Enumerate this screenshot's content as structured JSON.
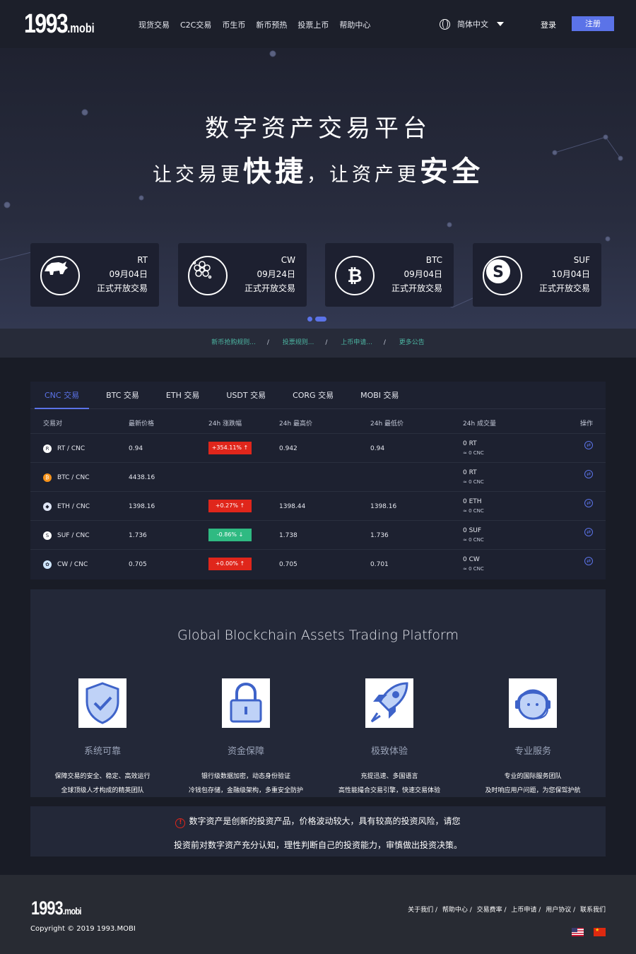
{
  "header": {
    "logo_main": "1993",
    "logo_suffix": ".mobi",
    "nav": [
      "现货交易",
      "C2C交易",
      "币生币",
      "新币预热",
      "投票上币",
      "帮助中心"
    ],
    "language": "简体中文",
    "login": "登录",
    "register": "注册"
  },
  "hero": {
    "title": "数字资产交易平台",
    "slogan_1": "让交易更",
    "slogan_2": "快捷",
    "slogan_3": "，让资产更",
    "slogan_4": "安全"
  },
  "launch_cards": [
    {
      "coin": "RT",
      "date": "09月04日",
      "status": "正式开放交易",
      "icon": "rhino-icon"
    },
    {
      "coin": "CW",
      "date": "09月24日",
      "status": "正式开放交易",
      "icon": "flower-icon"
    },
    {
      "coin": "BTC",
      "date": "09月04日",
      "status": "正式开放交易",
      "icon": "bitcoin-icon"
    },
    {
      "coin": "SUF",
      "date": "10月04日",
      "status": "正式开放交易",
      "icon": "suf-icon"
    }
  ],
  "announcements": [
    "新币抢购规则...",
    "投票规则...",
    "上币申请...",
    "更多公告"
  ],
  "market": {
    "tabs": [
      "CNC 交易",
      "BTC 交易",
      "ETH 交易",
      "USDT 交易",
      "CORG 交易",
      "MOBI 交易"
    ],
    "headers": [
      "交易对",
      "最新价格",
      "24h 涨跌幅",
      "24h 最高价",
      "24h 最低价",
      "24h 成交量",
      "操作"
    ],
    "rows": [
      {
        "pair": "RT / CNC",
        "price": "0.94",
        "change": "+354.11% ↑",
        "dir": "up",
        "high": "0.942",
        "low": "0.94",
        "vol": "0 RT",
        "vol_cnc": "≈ 0 CNC"
      },
      {
        "pair": "BTC / CNC",
        "price": "4438.16",
        "change": "",
        "dir": "",
        "high": "",
        "low": "",
        "vol": "0 RT",
        "vol_cnc": "≈ 0 CNC"
      },
      {
        "pair": "ETH / CNC",
        "price": "1398.16",
        "change": "+0.27% ↑",
        "dir": "up",
        "high": "1398.44",
        "low": "1398.16",
        "vol": "0 ETH",
        "vol_cnc": "≈ 0 CNC"
      },
      {
        "pair": "SUF / CNC",
        "price": "1.736",
        "change": "-0.86% ↓",
        "dir": "down",
        "high": "1.738",
        "low": "1.736",
        "vol": "0 SUF",
        "vol_cnc": "≈ 0 CNC"
      },
      {
        "pair": "CW / CNC",
        "price": "0.705",
        "change": "+0.00% ↑",
        "dir": "up",
        "high": "0.705",
        "low": "0.701",
        "vol": "0 CW",
        "vol_cnc": "≈ 0 CNC"
      }
    ]
  },
  "features": {
    "title": "Global Blockchain Assets Trading Platform",
    "items": [
      {
        "name": "系统可靠",
        "desc1": "保障交易的安全、稳定、高效运行",
        "desc2": "全球顶级人才构成的精英团队",
        "icon": "shield-check-icon"
      },
      {
        "name": "资金保障",
        "desc1": "银行级数据加密，动态身份验证",
        "desc2": "冷钱包存储，金融级架构，多重安全防护",
        "icon": "lock-icon"
      },
      {
        "name": "极致体验",
        "desc1": "充提迅速、多国语言",
        "desc2": "高性能撮合交易引擎，快速交易体验",
        "icon": "rocket-icon"
      },
      {
        "name": "专业服务",
        "desc1": "专业的国际服务团队",
        "desc2": "及时响应用户问题，为您保驾护航",
        "icon": "support-agent-icon"
      }
    ]
  },
  "risk_warning": {
    "line1": "数字资产是创新的投资产品，价格波动较大，具有较高的投资风险，请您",
    "line2": "投资前对数字资产充分认知，理性判断自己的投资能力，审慎做出投资决策。"
  },
  "footer": {
    "logo_main": "1993",
    "logo_suffix": ".mobi",
    "copyright": "Copyright © 2019 1993.MOBI",
    "links": [
      "关于我们",
      "帮助中心",
      "交易费率",
      "上币申请",
      "用户协议",
      "联系我们"
    ]
  },
  "colors": {
    "accent": "#5b73e8",
    "up": "#e0261b",
    "down": "#2fba82",
    "notice": "#4cb6a2"
  }
}
